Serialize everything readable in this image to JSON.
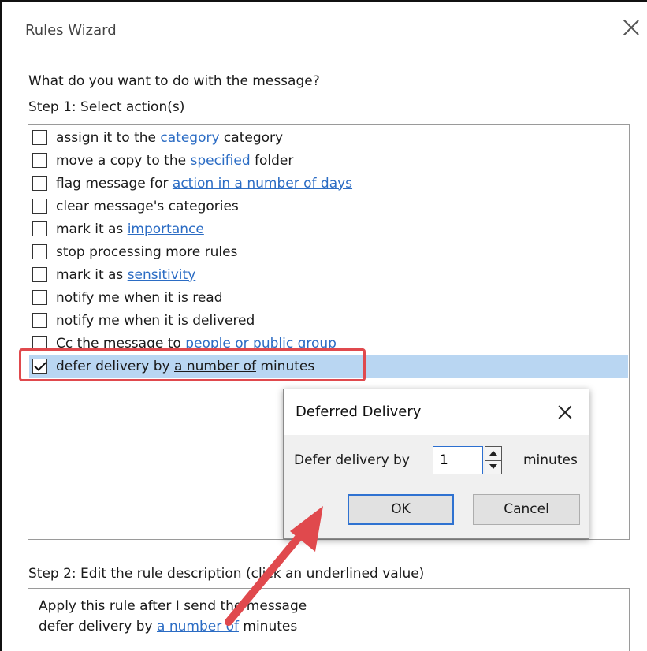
{
  "window": {
    "title": "Rules Wizard"
  },
  "prompt": {
    "question": "What do you want to do with the message?",
    "step1": "Step 1: Select action(s)"
  },
  "actions": [
    {
      "pre": "assign it to the ",
      "link": "category",
      "post": " category",
      "checked": false
    },
    {
      "pre": "move a copy to the ",
      "link": "specified",
      "post": " folder",
      "checked": false
    },
    {
      "pre": "flag message for ",
      "link": "action in a number of days",
      "post": "",
      "checked": false
    },
    {
      "pre": "clear message's categories",
      "link": "",
      "post": "",
      "checked": false
    },
    {
      "pre": "mark it as ",
      "link": "importance",
      "post": "",
      "checked": false
    },
    {
      "pre": "stop processing more rules",
      "link": "",
      "post": "",
      "checked": false
    },
    {
      "pre": "mark it as ",
      "link": "sensitivity",
      "post": "",
      "checked": false
    },
    {
      "pre": "notify me when it is read",
      "link": "",
      "post": "",
      "checked": false
    },
    {
      "pre": "notify me when it is delivered",
      "link": "",
      "post": "",
      "checked": false
    },
    {
      "pre": "Cc the message to ",
      "link": "people or public group",
      "post": "",
      "checked": false
    },
    {
      "pre": "defer delivery by ",
      "link": "a number of",
      "post": " minutes",
      "checked": true
    }
  ],
  "step2": {
    "label": "Step 2: Edit the rule description (click an underlined value)",
    "line1": "Apply this rule after I send the message",
    "line2_pre": "defer delivery by ",
    "line2_link": "a number of",
    "line2_post": " minutes"
  },
  "dialog": {
    "title": "Deferred Delivery",
    "label": "Defer delivery by",
    "value": "1",
    "unit": "minutes",
    "ok": "OK",
    "cancel": "Cancel"
  },
  "colors": {
    "link": "#2b6cc4",
    "selection": "#b9d6f2",
    "highlight": "#e0494d"
  }
}
